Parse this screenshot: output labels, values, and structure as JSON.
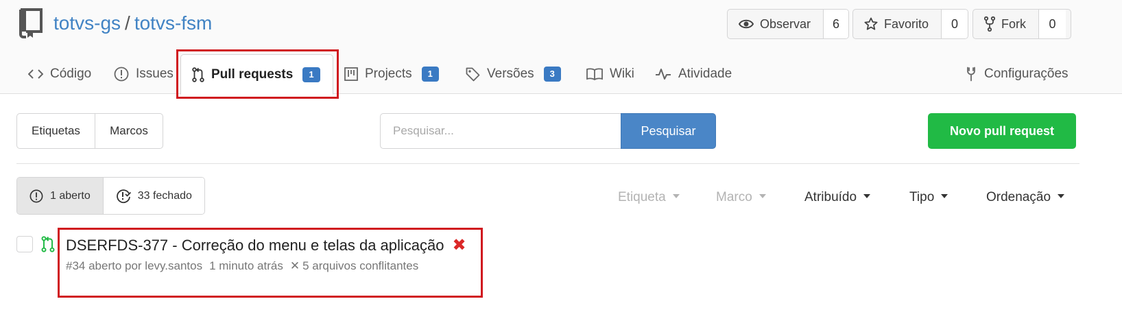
{
  "repo": {
    "owner": "totvs-gs",
    "separator": "/",
    "name": "totvs-fsm"
  },
  "actions": [
    {
      "label": "Observar",
      "icon": "eye-icon",
      "count": "6"
    },
    {
      "label": "Favorito",
      "icon": "star-icon",
      "count": "0"
    },
    {
      "label": "Fork",
      "icon": "fork-icon",
      "count": "0"
    }
  ],
  "tabs": [
    {
      "label": "Código",
      "icon": "code-icon"
    },
    {
      "label": "Issues",
      "icon": "issue-icon"
    },
    {
      "label": "Pull requests",
      "icon": "pull-request-icon",
      "badge": "1",
      "active": true
    },
    {
      "label": "Projects",
      "icon": "project-icon",
      "badge": "1"
    },
    {
      "label": "Versões",
      "icon": "tag-icon",
      "badge": "3"
    },
    {
      "label": "Wiki",
      "icon": "book-icon"
    },
    {
      "label": "Atividade",
      "icon": "pulse-icon"
    },
    {
      "label": "Configurações",
      "icon": "tools-icon"
    }
  ],
  "filters": {
    "labels_button": "Etiquetas",
    "milestones_button": "Marcos"
  },
  "search": {
    "placeholder": "Pesquisar...",
    "button": "Pesquisar"
  },
  "new_pr_button": "Novo pull request",
  "states": {
    "open": "1 aberto",
    "closed": "33 fechado"
  },
  "dropdowns": [
    {
      "label": "Etiqueta",
      "disabled": true
    },
    {
      "label": "Marco",
      "disabled": true
    },
    {
      "label": "Atribuído",
      "disabled": false
    },
    {
      "label": "Tipo",
      "disabled": false
    },
    {
      "label": "Ordenação",
      "disabled": false
    }
  ],
  "pull_requests": [
    {
      "title": "DSERFDS-377 - Correção do menu e telas da aplicação",
      "status_mark": "✖",
      "meta": "#34 aberto por levy.santos",
      "time": "1 minuto atrás",
      "conflicts_mark": "✕",
      "conflicts": "5 arquivos conflitantes"
    }
  ],
  "colors": {
    "link": "#4183c4",
    "badge": "#3a7ac3",
    "primary": "#4a86c7",
    "success": "#21ba45",
    "highlight": "#d0191f",
    "danger": "#db2828"
  }
}
